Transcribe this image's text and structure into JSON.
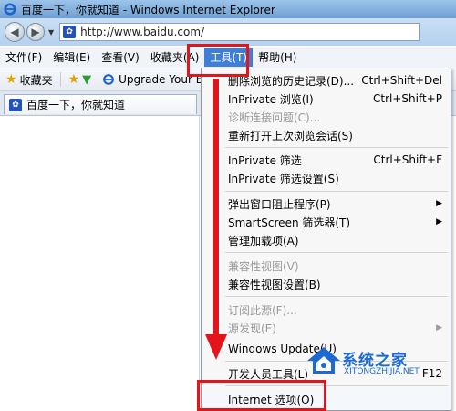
{
  "window": {
    "title": "百度一下，你就知道 - Windows Internet Explorer"
  },
  "address_bar": {
    "url": "http://www.baidu.com/"
  },
  "menu": {
    "items": [
      "文件(F)",
      "编辑(E)",
      "查看(V)",
      "收藏夹(A)",
      "工具(T)",
      "帮助(H)"
    ],
    "active": "工具(T)"
  },
  "favorites_bar": {
    "favorites_label": "收藏夹",
    "link_label": "Upgrade Your Br"
  },
  "tab": {
    "title": "百度一下，你就知道"
  },
  "tools_menu": {
    "items": [
      {
        "label": "删除浏览的历史记录(D)...",
        "shortcut": "Ctrl+Shift+Del",
        "disabled": false
      },
      {
        "label": "InPrivate 浏览(I)",
        "shortcut": "Ctrl+Shift+P",
        "disabled": false
      },
      {
        "label": "诊断连接问题(C)...",
        "shortcut": "",
        "disabled": true
      },
      {
        "label": "重新打开上次浏览会话(S)",
        "shortcut": "",
        "disabled": false
      },
      {
        "label": "InPrivate 筛选",
        "shortcut": "Ctrl+Shift+F",
        "disabled": false
      },
      {
        "label": "InPrivate 筛选设置(S)",
        "shortcut": "",
        "disabled": false
      },
      {
        "label": "弹出窗口阻止程序(P)",
        "shortcut": "",
        "disabled": false,
        "submenu": true
      },
      {
        "label": "SmartScreen 筛选器(T)",
        "shortcut": "",
        "disabled": false,
        "submenu": true
      },
      {
        "label": "管理加载项(A)",
        "shortcut": "",
        "disabled": false
      },
      {
        "label": "兼容性视图(V)",
        "shortcut": "",
        "disabled": true
      },
      {
        "label": "兼容性视图设置(B)",
        "shortcut": "",
        "disabled": false
      },
      {
        "label": "订阅此源(F)...",
        "shortcut": "",
        "disabled": true
      },
      {
        "label": "源发现(E)",
        "shortcut": "",
        "disabled": true,
        "submenu": true
      },
      {
        "label": "Windows Update(U)",
        "shortcut": "",
        "disabled": false
      },
      {
        "label": "开发人员工具(L)",
        "shortcut": "F12",
        "disabled": false
      },
      {
        "label": "Internet 选项(O)",
        "shortcut": "",
        "disabled": false
      }
    ]
  },
  "watermark": {
    "title": "系统之家",
    "subtitle": "XITONGZHIJIA.NET"
  },
  "colors": {
    "annotation_red": "#e3141a",
    "menu_active": "#3f7ed8",
    "watermark_blue": "#1c6ad1"
  }
}
